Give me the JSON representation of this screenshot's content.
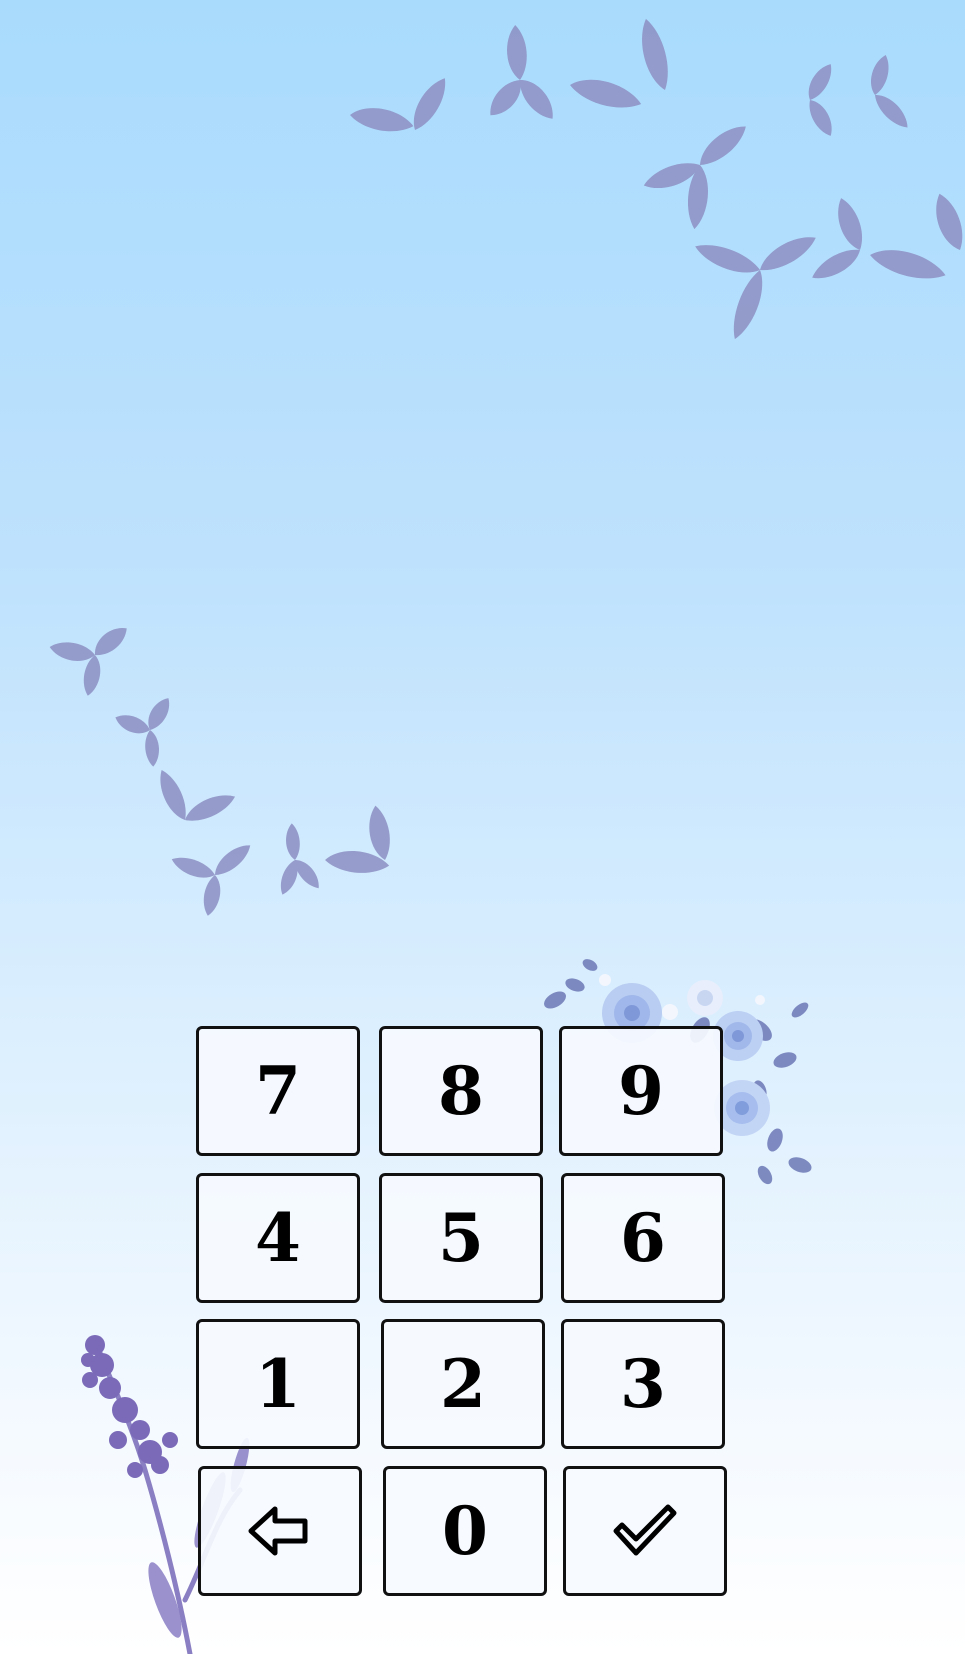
{
  "keypad": {
    "keys": {
      "seven": "7",
      "eight": "8",
      "nine": "9",
      "four": "4",
      "five": "5",
      "six": "6",
      "one": "1",
      "two": "2",
      "three": "3",
      "zero": "0"
    },
    "backspace_icon": "arrow-left-icon",
    "confirm_icon": "check-icon"
  },
  "colors": {
    "sky_top": "#a9dbfd",
    "sky_bottom": "#ffffff",
    "leaf": "#8f93c6",
    "flower_blue": "#b9cdf2",
    "lavender": "#7a6ab8"
  }
}
